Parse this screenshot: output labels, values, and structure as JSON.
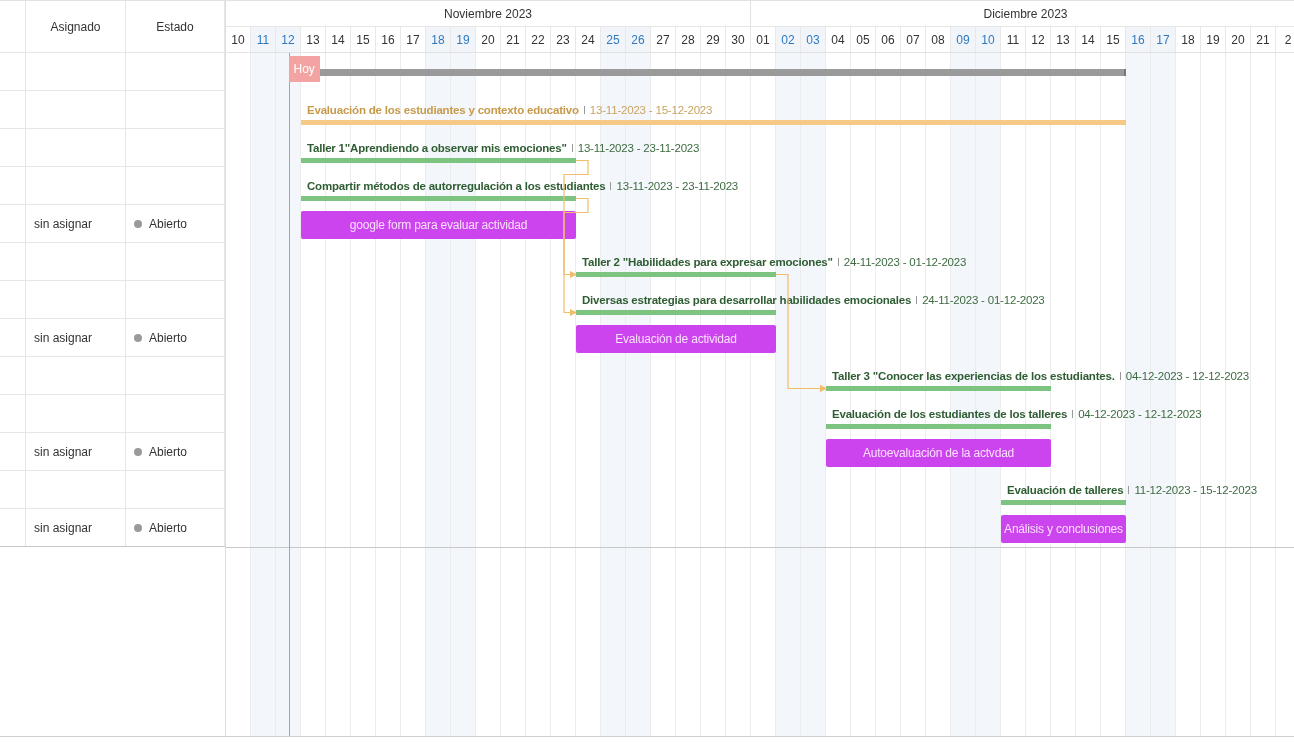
{
  "left_columns": [
    {
      "label": "Asignado"
    },
    {
      "label": "Estado"
    }
  ],
  "timeline": {
    "today": {
      "label": "Hoy"
    },
    "months": [
      {
        "label": "Noviembre 2023",
        "days": [
          {
            "label": "10",
            "weekend": false
          },
          {
            "label": "11",
            "weekend": true
          },
          {
            "label": "12",
            "weekend": true
          },
          {
            "label": "13",
            "weekend": false
          },
          {
            "label": "14",
            "weekend": false
          },
          {
            "label": "15",
            "weekend": false
          },
          {
            "label": "16",
            "weekend": false
          },
          {
            "label": "17",
            "weekend": false
          },
          {
            "label": "18",
            "weekend": true
          },
          {
            "label": "19",
            "weekend": true
          },
          {
            "label": "20",
            "weekend": false
          },
          {
            "label": "21",
            "weekend": false
          },
          {
            "label": "22",
            "weekend": false
          },
          {
            "label": "23",
            "weekend": false
          },
          {
            "label": "24",
            "weekend": false
          },
          {
            "label": "25",
            "weekend": true
          },
          {
            "label": "26",
            "weekend": true
          },
          {
            "label": "27",
            "weekend": false
          },
          {
            "label": "28",
            "weekend": false
          },
          {
            "label": "29",
            "weekend": false
          },
          {
            "label": "30",
            "weekend": false
          }
        ]
      },
      {
        "label": "Diciembre 2023",
        "days": [
          {
            "label": "01",
            "weekend": false
          },
          {
            "label": "02",
            "weekend": true
          },
          {
            "label": "03",
            "weekend": true
          },
          {
            "label": "04",
            "weekend": false
          },
          {
            "label": "05",
            "weekend": false
          },
          {
            "label": "06",
            "weekend": false
          },
          {
            "label": "07",
            "weekend": false
          },
          {
            "label": "08",
            "weekend": false
          },
          {
            "label": "09",
            "weekend": true
          },
          {
            "label": "10",
            "weekend": true
          },
          {
            "label": "11",
            "weekend": false
          },
          {
            "label": "12",
            "weekend": false
          },
          {
            "label": "13",
            "weekend": false
          },
          {
            "label": "14",
            "weekend": false
          },
          {
            "label": "15",
            "weekend": false
          },
          {
            "label": "16",
            "weekend": true
          },
          {
            "label": "17",
            "weekend": true
          },
          {
            "label": "18",
            "weekend": false
          },
          {
            "label": "19",
            "weekend": false
          },
          {
            "label": "20",
            "weekend": false
          },
          {
            "label": "21",
            "weekend": false
          },
          {
            "label": "2",
            "weekend": false
          }
        ]
      }
    ]
  },
  "rows": [
    {
      "kind": "project"
    },
    {
      "kind": "group",
      "name": "Evaluación de los estudiantes y contexto educativo",
      "dates": "13-11-2023 - 15-12-2023"
    },
    {
      "kind": "summary",
      "name": "Taller 1\"Aprendiendo a observar mis emociones\"",
      "dates": "13-11-2023 - 23-11-2023"
    },
    {
      "kind": "summary",
      "name": "Compartir métodos de autorregulación a los estudiantes",
      "dates": "13-11-2023 - 23-11-2023"
    },
    {
      "kind": "task",
      "name": "google form para evaluar actividad",
      "assignee": "sin asignar",
      "status": "Abierto"
    },
    {
      "kind": "summary",
      "name": "Taller 2 \"Habilidades para expresar emociones\"",
      "dates": "24-11-2023 - 01-12-2023"
    },
    {
      "kind": "summary",
      "name": "Diversas estrategias para desarrollar habilidades emocionales",
      "dates": "24-11-2023 - 01-12-2023"
    },
    {
      "kind": "task",
      "name": "Evaluación de actividad",
      "assignee": "sin asignar",
      "status": "Abierto"
    },
    {
      "kind": "summary",
      "name": "Taller 3 \"Conocer las experiencias de los estudiantes.",
      "dates": "04-12-2023 - 12-12-2023"
    },
    {
      "kind": "summary",
      "name": "Evaluación de los estudiantes de los talleres",
      "dates": "04-12-2023 - 12-12-2023"
    },
    {
      "kind": "task",
      "name": "Autoevaluación de la actvdad",
      "assignee": "sin asignar",
      "status": "Abierto"
    },
    {
      "kind": "summary",
      "name": "Evaluación de talleres",
      "dates": "11-12-2023 - 15-12-2023"
    },
    {
      "kind": "task",
      "name": "Análisis y conclusiones",
      "assignee": "sin asignar",
      "status": "Abierto"
    }
  ]
}
